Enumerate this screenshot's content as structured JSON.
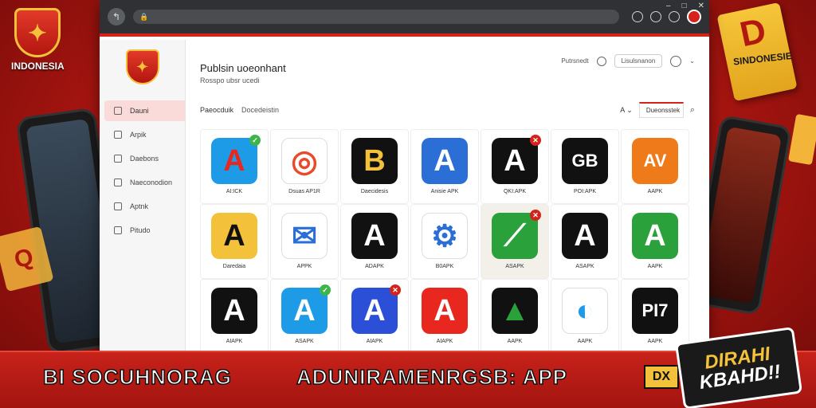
{
  "background": {
    "logo_caption": "INDONESIA",
    "tile_letter": "D",
    "tile_label": "SINDONESIE",
    "left_tile_letter": "Q"
  },
  "browser": {
    "url": "",
    "controls": [
      "–",
      "□",
      "✕"
    ]
  },
  "sidebar": {
    "items": [
      {
        "label": "Dauni",
        "active": true
      },
      {
        "label": "Arpik",
        "active": false
      },
      {
        "label": "Daebons",
        "active": false
      },
      {
        "label": "Naeconodion",
        "active": false
      },
      {
        "label": "Aptnk",
        "active": false
      },
      {
        "label": "Pitudo",
        "active": false
      }
    ]
  },
  "header": {
    "title": "Publsin uoeonhant",
    "subtitle": "Rosspo ubsr ucedi",
    "user_label": "Putrsnedt",
    "signin_label": "Lisulsnanon"
  },
  "filters": {
    "tabs": [
      "Paeocduik",
      "Docedeistin"
    ],
    "sort_label": "A",
    "dropdown_value": "Dueonsstek"
  },
  "apps": [
    {
      "glyph": "A",
      "label": "AI:ICK",
      "bg": "#1e9be6",
      "fg": "#e8271f",
      "badge": "✓",
      "badge_color": "green"
    },
    {
      "glyph": "◎",
      "label": "Dsuas AP1R",
      "bg": "#ffffff",
      "fg": "#e84a2a",
      "badge": "",
      "badge_color": ""
    },
    {
      "glyph": "B",
      "label": "Daecidesis",
      "bg": "#111111",
      "fg": "#f3c23a",
      "badge": "",
      "badge_color": ""
    },
    {
      "glyph": "A",
      "label": "Anisie APK",
      "bg": "#2b6fd6",
      "fg": "#ffffff",
      "badge": "",
      "badge_color": ""
    },
    {
      "glyph": "A",
      "label": "QKI:APK",
      "bg": "#111111",
      "fg": "#ffffff",
      "badge": "✕",
      "badge_color": "red"
    },
    {
      "glyph": "GB",
      "label": "POI:APK",
      "bg": "#111111",
      "fg": "#ffffff",
      "badge": "",
      "badge_color": ""
    },
    {
      "glyph": "AV",
      "label": "AAPK",
      "bg": "#ef7a1a",
      "fg": "#ffffff",
      "badge": "",
      "badge_color": ""
    },
    {
      "glyph": "A",
      "label": "Daredaia",
      "bg": "#f3c23a",
      "fg": "#111111",
      "badge": "",
      "badge_color": ""
    },
    {
      "glyph": "✉",
      "label": "APPK",
      "bg": "#ffffff",
      "fg": "#2b6fd6",
      "badge": "",
      "badge_color": ""
    },
    {
      "glyph": "A",
      "label": "ADAPK",
      "bg": "#111111",
      "fg": "#ffffff",
      "badge": "",
      "badge_color": ""
    },
    {
      "glyph": "⚙",
      "label": "B0APK",
      "bg": "#ffffff",
      "fg": "#2b6fd6",
      "badge": "",
      "badge_color": ""
    },
    {
      "glyph": "⟋",
      "label": "ASAPK",
      "bg": "#2aa13a",
      "fg": "#ffffff",
      "badge": "✕",
      "badge_color": "red"
    },
    {
      "glyph": "A",
      "label": "ASAPK",
      "bg": "#111111",
      "fg": "#ffffff",
      "badge": "",
      "badge_color": ""
    },
    {
      "glyph": "A",
      "label": "AAPK",
      "bg": "#2aa13a",
      "fg": "#ffffff",
      "badge": "",
      "badge_color": ""
    },
    {
      "glyph": "A",
      "label": "AIAPK",
      "bg": "#111111",
      "fg": "#ffffff",
      "badge": "",
      "badge_color": ""
    },
    {
      "glyph": "A",
      "label": "ASAPK",
      "bg": "#1e9be6",
      "fg": "#ffffff",
      "badge": "✓",
      "badge_color": "green"
    },
    {
      "glyph": "A",
      "label": "AIAPK",
      "bg": "#2b4fd6",
      "fg": "#ffffff",
      "badge": "✕",
      "badge_color": "red"
    },
    {
      "glyph": "A",
      "label": "AIAPK",
      "bg": "#e8271f",
      "fg": "#ffffff",
      "badge": "",
      "badge_color": ""
    },
    {
      "glyph": "▲",
      "label": "AAPK",
      "bg": "#111111",
      "fg": "#2aa13a",
      "badge": "",
      "badge_color": ""
    },
    {
      "glyph": "◐",
      "label": "AAPK",
      "bg": "#ffffff",
      "fg": "#1e9be6",
      "badge": "",
      "badge_color": ""
    },
    {
      "glyph": "PI7",
      "label": "AAPK",
      "bg": "#111111",
      "fg": "#ffffff",
      "badge": "",
      "badge_color": ""
    }
  ],
  "banner": {
    "left_text": "BI SOCUHNORAG",
    "right_text": "ADUNIRAMENRGSB: APP",
    "logo_text": "DX",
    "sticker_line1": "DIRAHI",
    "sticker_line2": "KBAHD!!"
  }
}
